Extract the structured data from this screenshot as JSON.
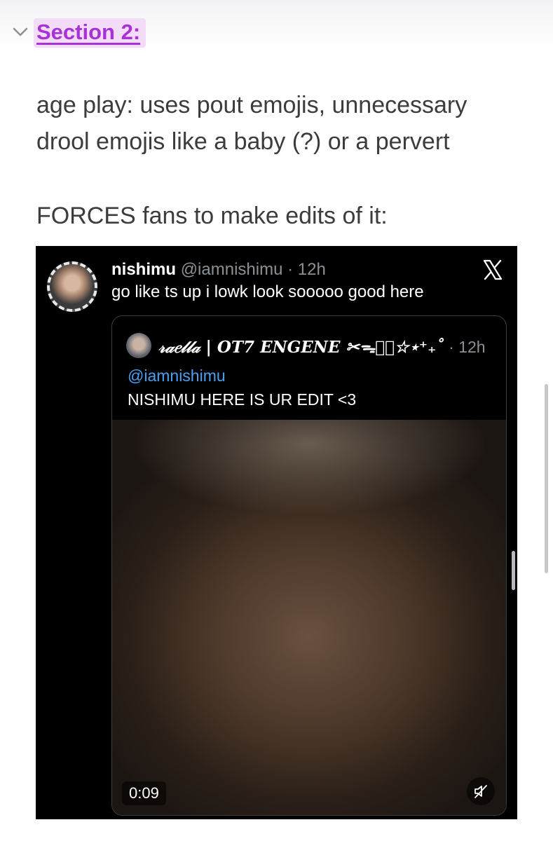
{
  "section": {
    "heading": "Section 2:",
    "toggle_icon": "chevron-down-icon",
    "heading_color": "#a832d6",
    "highlight_color": "#f3dcf7"
  },
  "paragraphs": [
    {
      "lines": [
        "age play: uses pout emojis, unnecessary",
        "drool emojis like a baby (?) or a pervert"
      ]
    },
    {
      "lines": [
        "FORCES fans to make edits of it:"
      ]
    }
  ],
  "tweet": {
    "display_name": "nishimu",
    "handle": "@iamnishimu",
    "separator": "·",
    "time": "12h",
    "text": "go like ts up i lowk look sooooo good here",
    "platform_icon": "x-logo-icon",
    "quote": {
      "display_name": "𝓇𝒶𝑒𝓁𝓁𝒶 | OT7 ENGENE ✂︎ᯓ✰⃝☆⋆⁺₊˚",
      "time": "12h",
      "mention": "@iamnishimu",
      "text": "NISHIMU HERE IS UR EDIT <3",
      "video": {
        "duration": "0:09",
        "muted": true
      }
    }
  },
  "colors": {
    "mention": "#4aa0f0",
    "meta": "#8b9096",
    "body_text": "#3c3c3e"
  }
}
